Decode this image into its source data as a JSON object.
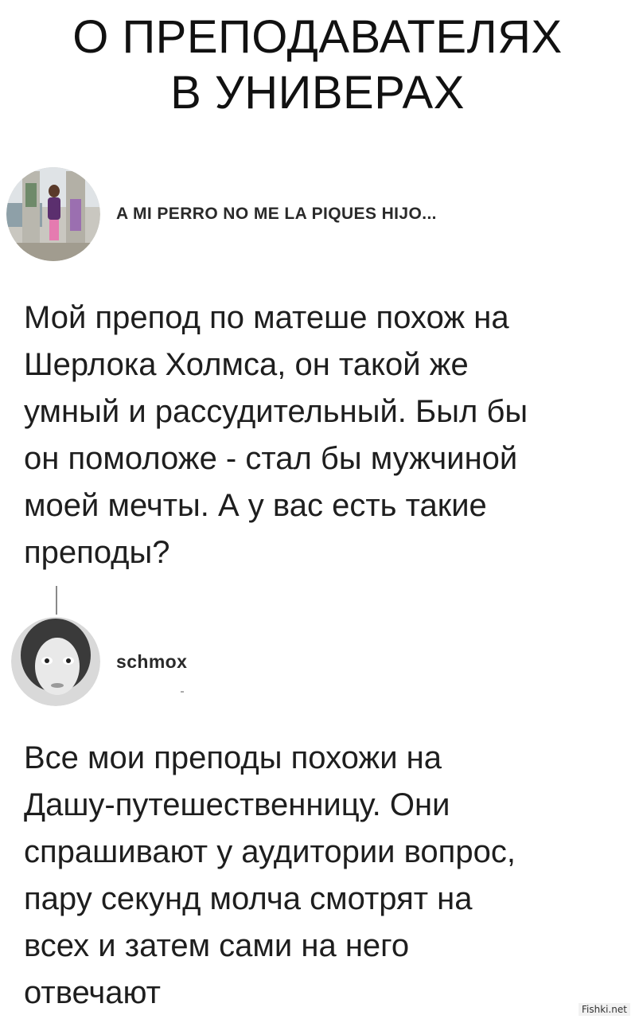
{
  "title": {
    "line1": "О ПРЕПОДАВАТЕЛЯХ",
    "line2": "В УНИВЕРАХ"
  },
  "posts": [
    {
      "username": "A MI PERRO NO ME LA PIQUES HIJO...",
      "text_lines": [
        "Мой препод по матеше похож на",
        "Шерлока Холмса, он такой же",
        "умный и рассудительный. Был бы",
        "он помоложе - стал бы мужчиной",
        "моей мечты. А у вас есть такие",
        "преподы?"
      ]
    },
    {
      "username": "schmox",
      "text_lines": [
        "Все мои преподы похожи на",
        "Дашу-путешественницу. Они",
        "спрашивают у аудитории вопрос,",
        "пару секунд молча смотрят на",
        "всех и затем сами на него",
        "отвечают"
      ]
    }
  ],
  "watermark": "Fishki.net"
}
